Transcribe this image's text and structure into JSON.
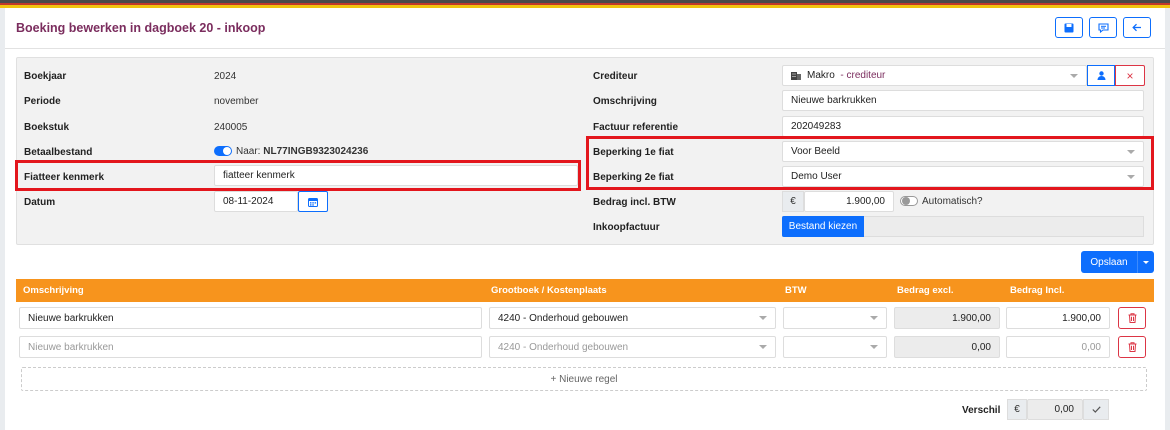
{
  "header": {
    "title": "Boeking bewerken in dagboek 20 - inkoop"
  },
  "toolbar": {
    "icons": [
      "save-icon",
      "comment-icon",
      "arrow-left-icon"
    ]
  },
  "left": {
    "boekjaar_label": "Boekjaar",
    "boekjaar_value": "2024",
    "periode_label": "Periode",
    "periode_value": "november",
    "boekstuk_label": "Boekstuk",
    "boekstuk_value": "240005",
    "betaalbestand_label": "Betaalbestand",
    "betaalbestand_prefix": "Naar:",
    "betaalbestand_iban": "NL77INGB9323024236",
    "fiatteer_label": "Fiatteer kenmerk",
    "fiatteer_value": "fiatteer kenmerk",
    "datum_label": "Datum",
    "datum_value": "08-11-2024"
  },
  "right": {
    "crediteur_label": "Crediteur",
    "crediteur_name": "Makro",
    "crediteur_sep": "-",
    "crediteur_type": "crediteur",
    "omschrijving_label": "Omschrijving",
    "omschrijving_value": "Nieuwe barkrukken",
    "factuur_label": "Factuur referentie",
    "factuur_value": "202049283",
    "fiat1_label": "Beperking 1e fiat",
    "fiat1_value": "Voor Beeld",
    "fiat2_label": "Beperking 2e fiat",
    "fiat2_value": "Demo User",
    "bedrag_label": "Bedrag incl. BTW",
    "currency": "€",
    "bedrag_value": "1.900,00",
    "automatisch_label": "Automatisch?",
    "inkoopfactuur_label": "Inkoopfactuur",
    "bestand_button": "Bestand kiezen"
  },
  "actions": {
    "opslaan": "Opslaan"
  },
  "table": {
    "headers": [
      "Omschrijving",
      "Grootboek / Kostenplaats",
      "BTW",
      "Bedrag excl.",
      "Bedrag Incl."
    ],
    "rows": [
      {
        "omschrijving": "Nieuwe barkrukken",
        "grootboek": "4240 - Onderhoud gebouwen",
        "btw": "",
        "excl": "1.900,00",
        "incl": "1.900,00",
        "placeholder": false
      },
      {
        "omschrijving": "Nieuwe barkrukken",
        "grootboek": "4240 - Onderhoud gebouwen",
        "btw": "",
        "excl": "0,00",
        "incl": "0,00",
        "placeholder": true
      }
    ],
    "add_row": "+ Nieuwe regel"
  },
  "footer": {
    "verschil_label": "Verschil",
    "currency": "€",
    "verschil_value": "0,00"
  },
  "colors": {
    "accent": "#0d6efd",
    "header_orange": "#f7941d",
    "title": "#7b2d5e",
    "highlight": "#e3161d",
    "danger": "#dc3545"
  }
}
